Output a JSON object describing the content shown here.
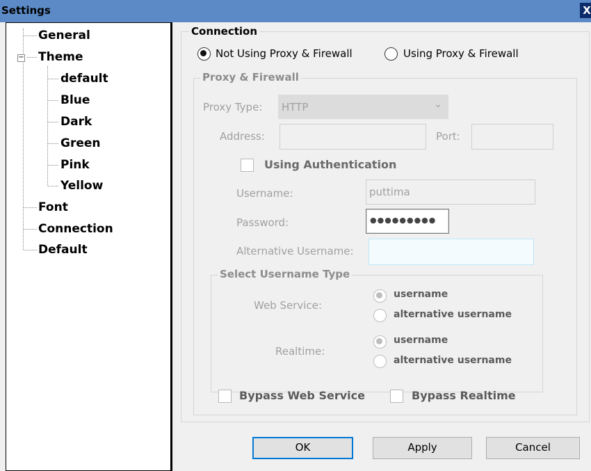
{
  "window": {
    "title": "Settings",
    "close_label": "X"
  },
  "tree": {
    "general": "General",
    "theme": "Theme",
    "themes": [
      "default",
      "Blue",
      "Dark",
      "Green",
      "Pink",
      "Yellow"
    ],
    "font": "Font",
    "connection": "Connection",
    "default": "Default",
    "expander": "−"
  },
  "connection": {
    "legend": "Connection",
    "options": [
      "Not Using Proxy & Firewall",
      "Using Proxy & Firewall"
    ],
    "selected": "Not Using Proxy & Firewall"
  },
  "proxy": {
    "legend": "Proxy & Firewall",
    "type_label": "Proxy Type:",
    "type_value": "HTTP",
    "address_label": "Address:",
    "address_value": "",
    "port_label": "Port:",
    "port_value": "",
    "auth_label": "Using Authentication",
    "username_label": "Username:",
    "username_value": "puttima",
    "password_label": "Password:",
    "password_value": "●●●●●●●●●",
    "alt_username_label": "Alternative Username:",
    "alt_username_value": ""
  },
  "username_type": {
    "legend": "Select Username Type",
    "web_service_label": "Web Service:",
    "realtime_label": "Realtime:",
    "option_username": "username",
    "option_alternative": "alternative username",
    "web_service_selected": "username",
    "realtime_selected": "username"
  },
  "bypass": {
    "web_service": "Bypass Web Service",
    "realtime": "Bypass Realtime"
  },
  "buttons": {
    "ok": "OK",
    "apply": "Apply",
    "cancel": "Cancel"
  }
}
